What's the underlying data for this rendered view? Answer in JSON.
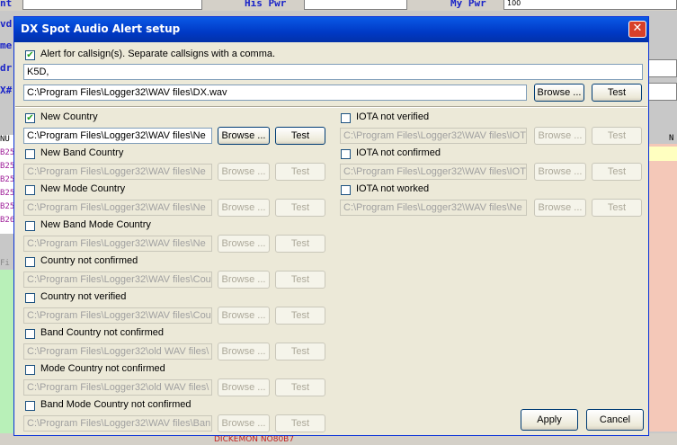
{
  "background": {
    "labels": [
      "nt",
      "His Pwr",
      "My Pwr",
      "vd",
      "me",
      "dr",
      "X#"
    ],
    "my_pwr_value": "100",
    "left_rows": [
      "NU",
      "B25",
      "B25",
      "B25",
      "B25",
      "B25",
      "B26"
    ],
    "left_tab": "Fi",
    "right_col_header": "N",
    "bottom_call": "DICKEMON NO80B7"
  },
  "dialog": {
    "title": "DX Spot Audio Alert setup",
    "close_glyph": "✕",
    "alert_callsigns": {
      "checked": true,
      "label": "Alert for callsign(s).  Separate callsigns with a comma.",
      "value": "K5D,",
      "wav_path": "C:\\Program Files\\Logger32\\WAV files\\DX.wav",
      "browse_label": "Browse ...",
      "test_label": "Test"
    },
    "left_alerts": [
      {
        "label": "New Country",
        "checked": true,
        "path": "C:\\Program Files\\Logger32\\WAV files\\Ne",
        "browse": "Browse ...",
        "test": "Test"
      },
      {
        "label": "New Band Country",
        "checked": false,
        "path": "C:\\Program Files\\Logger32\\WAV files\\Ne",
        "browse": "Browse ...",
        "test": "Test"
      },
      {
        "label": "New Mode Country",
        "checked": false,
        "path": "C:\\Program Files\\Logger32\\WAV files\\Ne",
        "browse": "Browse ...",
        "test": "Test"
      },
      {
        "label": "New Band Mode Country",
        "checked": false,
        "path": "C:\\Program Files\\Logger32\\WAV files\\Ne",
        "browse": "Browse ...",
        "test": "Test"
      },
      {
        "label": "Country not confirmed",
        "checked": false,
        "path": "C:\\Program Files\\Logger32\\WAV files\\Cou",
        "browse": "Browse ...",
        "test": "Test"
      },
      {
        "label": "Country not verified",
        "checked": false,
        "path": "C:\\Program Files\\Logger32\\WAV files\\Cou",
        "browse": "Browse ...",
        "test": "Test"
      },
      {
        "label": "Band Country not confirmed",
        "checked": false,
        "path": "C:\\Program Files\\Logger32\\old WAV files\\",
        "browse": "Browse ...",
        "test": "Test"
      },
      {
        "label": "Mode Country not confirmed",
        "checked": false,
        "path": "C:\\Program Files\\Logger32\\old WAV files\\",
        "browse": "Browse ...",
        "test": "Test"
      },
      {
        "label": "Band Mode Country not confirmed",
        "checked": false,
        "path": "C:\\Program Files\\Logger32\\WAV files\\Ban",
        "browse": "Browse ...",
        "test": "Test"
      }
    ],
    "right_alerts": [
      {
        "label": "IOTA not verified",
        "checked": false,
        "path": "C:\\Program Files\\Logger32\\WAV files\\IOT",
        "browse": "Browse ...",
        "test": "Test"
      },
      {
        "label": "IOTA not confirmed",
        "checked": false,
        "path": "C:\\Program Files\\Logger32\\WAV files\\IOT",
        "browse": "Browse ...",
        "test": "Test"
      },
      {
        "label": "IOTA not worked",
        "checked": false,
        "path": "C:\\Program Files\\Logger32\\WAV files\\Ne",
        "browse": "Browse ...",
        "test": "Test"
      }
    ],
    "apply_label": "Apply",
    "cancel_label": "Cancel"
  }
}
